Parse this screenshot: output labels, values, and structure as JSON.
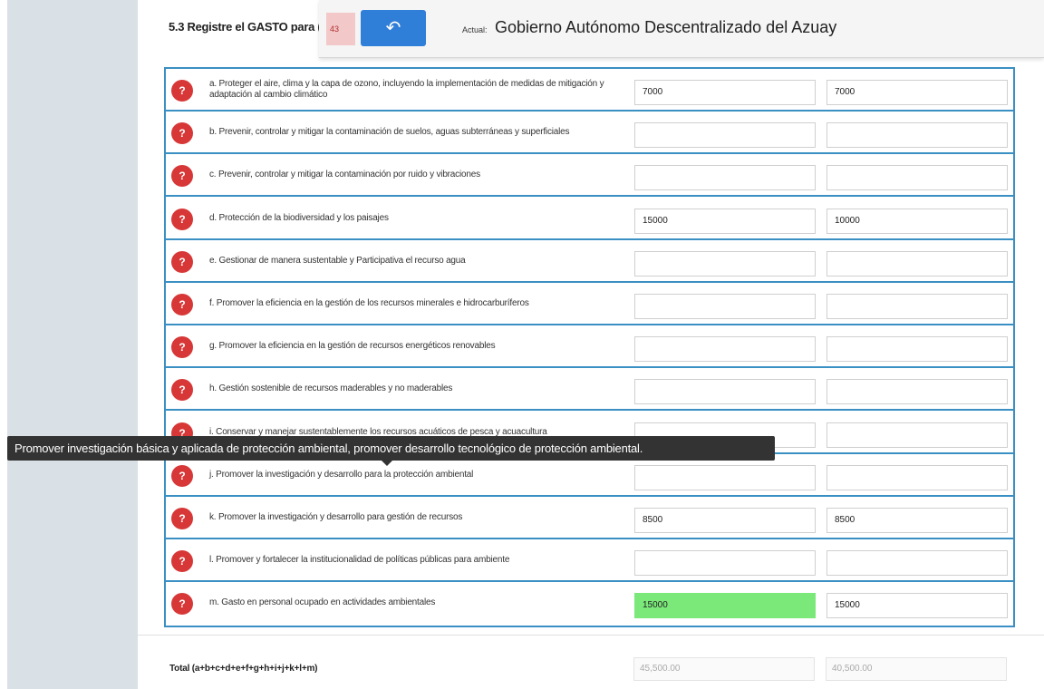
{
  "section": {
    "title": "5.3 Registre el GASTO para ("
  },
  "topbar": {
    "question_number": "43",
    "back_icon": "undo-arrow-icon",
    "actual_label": "Actual:",
    "actual_value": "Gobierno Autónomo Descentralizado del Azuay"
  },
  "help_icon": "?",
  "rows": [
    {
      "label": "a. Proteger el aire, clima y la capa de ozono, incluyendo la implementación de medidas de mitigación y adaptación al cambio climático",
      "value1": "7000",
      "value2": "7000"
    },
    {
      "label": "b. Prevenir, controlar y mitigar la contaminación de suelos, aguas subterráneas y superficiales",
      "value1": "",
      "value2": ""
    },
    {
      "label": "c. Prevenir, controlar y mitigar la contaminación por ruido y vibraciones",
      "value1": "",
      "value2": ""
    },
    {
      "label": "d. Protección de la biodiversidad y los paisajes",
      "value1": "15000",
      "value2": "10000"
    },
    {
      "label": "e. Gestionar de manera sustentable y Participativa el recurso agua",
      "value1": "",
      "value2": ""
    },
    {
      "label": "f. Promover la eficiencia en la gestión de los recursos minerales e hidrocarburíferos",
      "value1": "",
      "value2": ""
    },
    {
      "label": "g. Promover la eficiencia en la gestión de recursos energéticos renovables",
      "value1": "",
      "value2": ""
    },
    {
      "label": "h. Gestión sostenible de recursos maderables y no maderables",
      "value1": "",
      "value2": ""
    },
    {
      "label": "i. Conservar y manejar sustentablemente los recursos acuáticos de pesca y acuacultura",
      "value1": "",
      "value2": ""
    },
    {
      "label": "j. Promover la investigación y desarrollo para la protección ambiental",
      "value1": "",
      "value2": ""
    },
    {
      "label": "k. Promover la investigación y desarrollo para gestión de recursos",
      "value1": "8500",
      "value2": "8500"
    },
    {
      "label": "l. Promover y fortalecer la institucionalidad de políticas públicas para ambiente",
      "value1": "",
      "value2": ""
    },
    {
      "label": "m. Gasto en personal ocupado en actividades ambientales",
      "value1": "15000",
      "value2": "15000"
    }
  ],
  "tooltip": {
    "text": "Promover investigación básica y aplicada de protección ambiental, promover desarrollo tecnológico de protección ambiental."
  },
  "total": {
    "label": "Total (a+b+c+d+e+f+g+h+i+j+k+l+m)",
    "value1": "45,500.00",
    "value2": "40,500.00"
  },
  "colors": {
    "sidebar": "#d9e0e6",
    "table_border": "#3a8fc3",
    "help_button": "#d73737",
    "back_button": "#2f7ed8",
    "highlight_input": "#7ae97a",
    "tooltip_bg": "#333333"
  }
}
